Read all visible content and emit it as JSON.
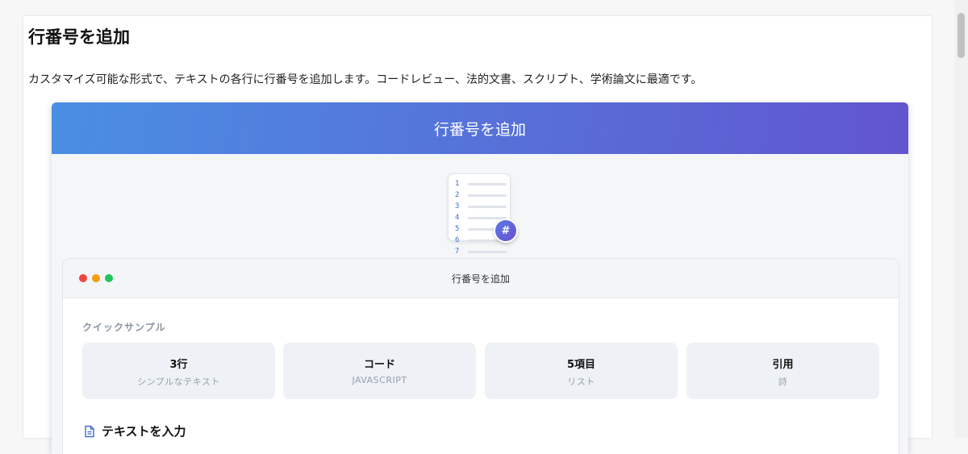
{
  "page": {
    "title": "行番号を追加",
    "description": "カスタマイズ可能な形式で、テキストの各行に行番号を追加します。コードレビュー、法的文書、スクリプト、学術論文に最適です。"
  },
  "tool": {
    "banner_title": "行番号を追加",
    "illustration": {
      "line_numbers": [
        "1",
        "2",
        "3",
        "4",
        "5",
        "6",
        "7"
      ],
      "badge": "#"
    },
    "window": {
      "title": "行番号を追加",
      "dots": [
        "#ef4444",
        "#f59e0b",
        "#22c55e"
      ]
    },
    "quick_samples": {
      "label": "クイックサンプル",
      "items": [
        {
          "name": "3行",
          "sub": "シンプルなテキスト"
        },
        {
          "name": "コード",
          "sub": "JAVASCRIPT"
        },
        {
          "name": "5項目",
          "sub": "リスト"
        },
        {
          "name": "引用",
          "sub": "詩"
        }
      ]
    },
    "input": {
      "label": "テキストを入力",
      "icon": "document-icon"
    }
  },
  "colors": {
    "banner_start": "#4a8fe3",
    "banner_end": "#6255cf",
    "accent": "#3e6fd0"
  }
}
